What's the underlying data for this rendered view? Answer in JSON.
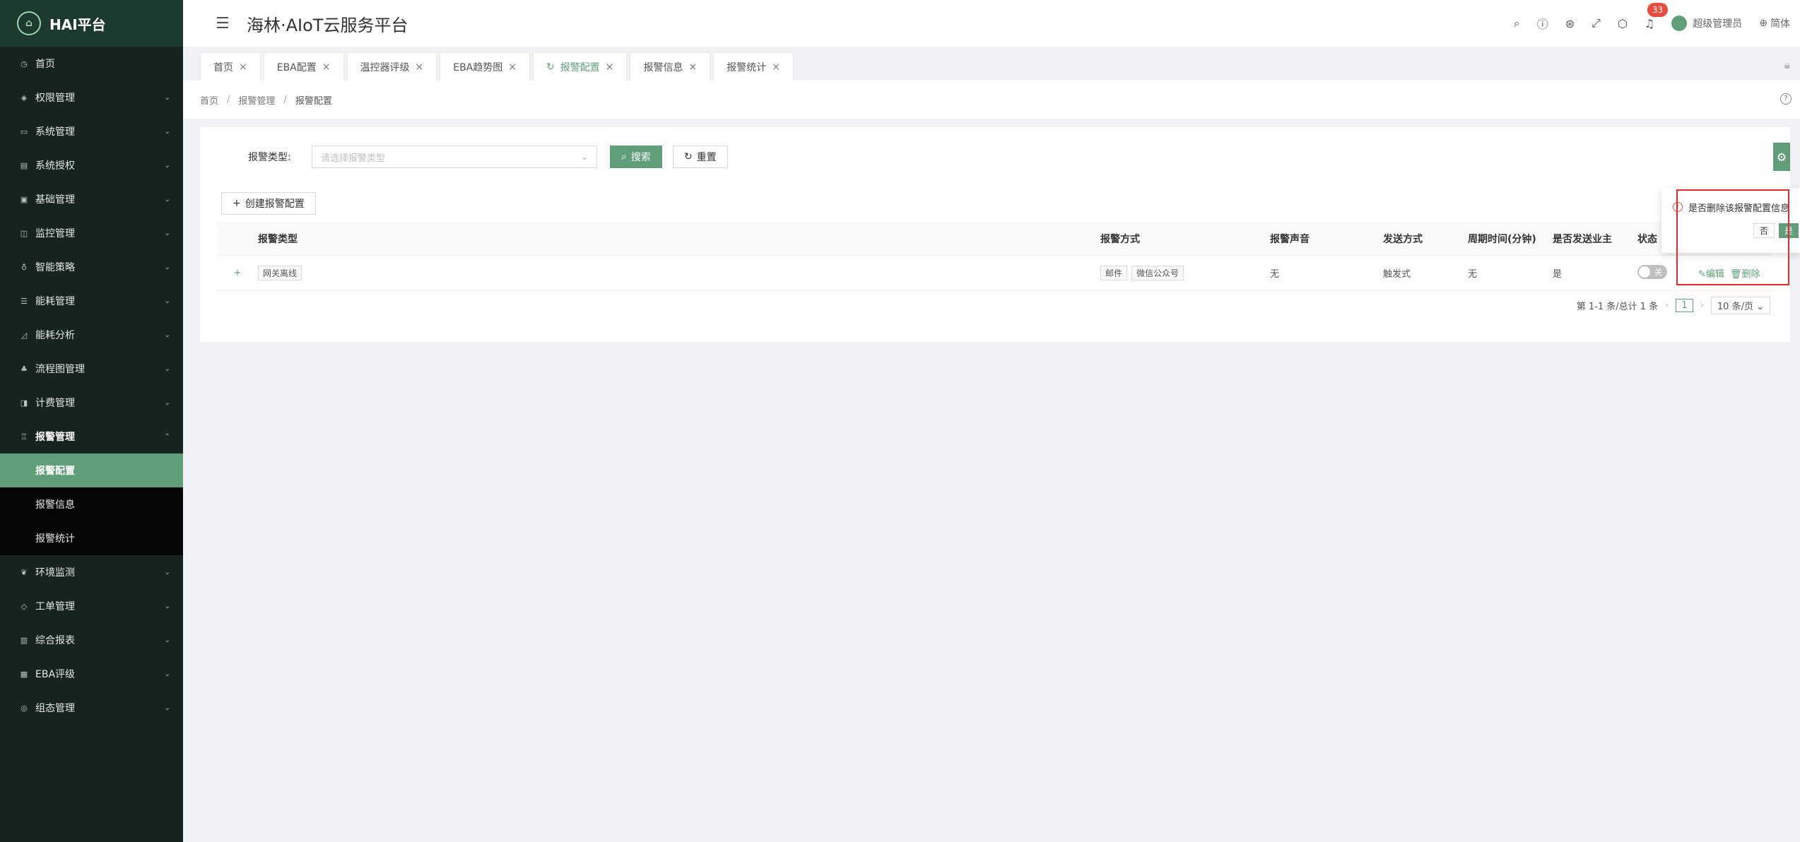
{
  "brand": {
    "logo_text": "HAI平台"
  },
  "header": {
    "title": "海林·AIoT云服务平台",
    "notification_count": "33",
    "user": "超级管理员",
    "lang": "简体"
  },
  "sidebar": {
    "items": [
      {
        "label": "首页",
        "icon": "home-icon"
      },
      {
        "label": "权限管理",
        "icon": "shield-icon"
      },
      {
        "label": "系统管理",
        "icon": "monitor-icon"
      },
      {
        "label": "系统授权",
        "icon": "license-icon"
      },
      {
        "label": "基础管理",
        "icon": "database-icon"
      },
      {
        "label": "监控管理",
        "icon": "camera-icon"
      },
      {
        "label": "智能策略",
        "icon": "bulb-icon"
      },
      {
        "label": "能耗管理",
        "icon": "sliders-icon"
      },
      {
        "label": "能耗分析",
        "icon": "chart-icon"
      },
      {
        "label": "流程图管理",
        "icon": "flow-icon"
      },
      {
        "label": "计费管理",
        "icon": "billing-icon"
      },
      {
        "label": "报警管理",
        "icon": "alarm-icon"
      }
    ],
    "sub_items": [
      {
        "label": "报警配置"
      },
      {
        "label": "报警信息"
      },
      {
        "label": "报警统计"
      }
    ],
    "items_after": [
      {
        "label": "环境监测",
        "icon": "leaf-icon"
      },
      {
        "label": "工单管理",
        "icon": "layers-icon"
      },
      {
        "label": "综合报表",
        "icon": "report-icon"
      },
      {
        "label": "EBA评级",
        "icon": "rating-icon"
      },
      {
        "label": "组态管理",
        "icon": "config-icon"
      }
    ]
  },
  "tabs": [
    {
      "label": "首页"
    },
    {
      "label": "EBA配置"
    },
    {
      "label": "温控器评级"
    },
    {
      "label": "EBA趋势图"
    },
    {
      "label": "报警配置"
    },
    {
      "label": "报警信息"
    },
    {
      "label": "报警统计"
    }
  ],
  "breadcrumb": {
    "home": "首页",
    "parent": "报警管理",
    "current": "报警配置"
  },
  "filter": {
    "label": "报警类型:",
    "placeholder": "请选择报警类型",
    "search": "搜索",
    "reset": "重置"
  },
  "create_button": "创建报警配置",
  "table": {
    "columns": [
      "报警类型",
      "报警方式",
      "报警声音",
      "发送方式",
      "周期时间(分钟)",
      "是否发送业主",
      "状态"
    ],
    "rows": [
      {
        "expand": "+",
        "type": "网关离线",
        "methods": [
          "邮件",
          "微信公众号"
        ],
        "sound": "无",
        "send": "触发式",
        "period": "无",
        "owner": "是",
        "status_label": "关",
        "edit": "编辑",
        "delete": "删除"
      }
    ]
  },
  "pagination": {
    "summary": "第 1-1 条/总计 1 条",
    "page": "1",
    "size": "10 条/页"
  },
  "popconfirm": {
    "text": "是否删除该报警配置信息",
    "no": "否",
    "yes": "是"
  },
  "colors": {
    "accent": "#5f9e79",
    "sidebar": "#16231f",
    "danger": "#e02b2b"
  }
}
